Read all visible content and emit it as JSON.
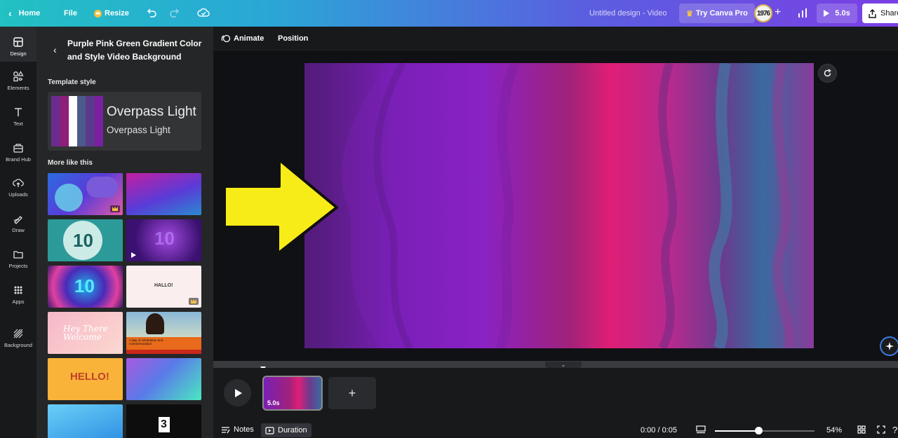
{
  "topbar": {
    "home": "Home",
    "file": "File",
    "resize": "Resize",
    "title": "Untitled design - Video",
    "try_pro": "Try Canva Pro",
    "avatar": "1976",
    "play_duration": "5.0s",
    "share": "Share"
  },
  "rail": [
    {
      "label": "Design",
      "icon": "design-icon"
    },
    {
      "label": "Elements",
      "icon": "elements-icon"
    },
    {
      "label": "Text",
      "icon": "text-icon"
    },
    {
      "label": "Brand Hub",
      "icon": "brand-hub-icon"
    },
    {
      "label": "Uploads",
      "icon": "uploads-icon"
    },
    {
      "label": "Draw",
      "icon": "draw-icon"
    },
    {
      "label": "Projects",
      "icon": "projects-icon"
    },
    {
      "label": "Apps",
      "icon": "apps-icon"
    },
    {
      "label": "Background",
      "icon": "background-icon"
    }
  ],
  "panel": {
    "title": "Purple Pink Green Gradient Color and Style Video Background",
    "template_style_heading": "Template style",
    "font_heading": "Overpass Light",
    "font_body": "Overpass Light",
    "swatch_colors": [
      "#6b2c8e",
      "#8b1f7a",
      "#ffffff",
      "#4a5a8a",
      "#5a3a8a",
      "#7a1fa0"
    ],
    "more_heading": "More like this",
    "thumb_texts": {
      "t3": "10",
      "t4": "10",
      "t5": "10",
      "t6": "HALLO!",
      "t7": "Hey There Welcome",
      "t8": "A day of celebration and commemoration",
      "t9": "HELLO!",
      "t12": "3"
    }
  },
  "subbar": {
    "animate": "Animate",
    "position": "Position"
  },
  "timeline": {
    "clip_duration": "5.0s",
    "add": "+",
    "notes": "Notes",
    "duration": "Duration",
    "time": "0:00 / 0:05",
    "zoom": "54%",
    "zoom_level": 0.44
  },
  "colors": {
    "accent_arrow": "#f7ec17",
    "topbar_start": "#22c1c3",
    "topbar_end": "#7a3fe4"
  }
}
